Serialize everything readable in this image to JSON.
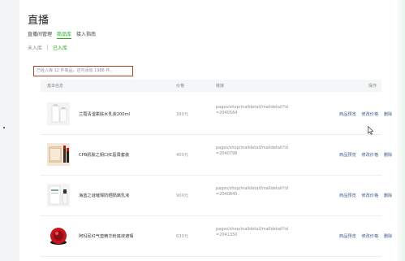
{
  "page": {
    "title": "直播"
  },
  "tabs": [
    {
      "label": "直播间管理"
    },
    {
      "label": "商品库"
    },
    {
      "label": "接入指南"
    }
  ],
  "subtabs": [
    {
      "label": "未入库"
    },
    {
      "label": "已入库"
    }
  ],
  "notice": "已经入库 12 件商品，还可添加 1988 件。",
  "table": {
    "headers": {
      "info": "基本信息",
      "price": "价格",
      "link": "链接",
      "actions": "操作"
    },
    "rows": [
      {
        "name": "兰蔻清滢柔肤水乳液200ml",
        "price": "390元",
        "link": "pages/shop/malldetail/malldetail?id=2040564",
        "icon": "lotion-bottle-icon"
      },
      {
        "name": "CPB肌肤之钥口红唇膏套装",
        "price": "400元",
        "link": "pages/shop/malldetail/malldetail?id=2040798",
        "icon": "lipstick-set-icon"
      },
      {
        "name": "海蓝之谜璀璨防晒隔离乳液",
        "price": "900元",
        "link": "pages/shop/malldetail/malldetail?id=2040845",
        "icon": "sunscreen-icon"
      },
      {
        "name": "阿玛尼红气垫精华粉底液遮瑕",
        "price": "630元",
        "link": "pages/shop/malldetail/malldetail?id=2041350",
        "icon": "cushion-compact-icon"
      }
    ],
    "actions": {
      "preview": "商品预览",
      "edit_price": "修改价格",
      "delete": "删除"
    }
  },
  "colors": {
    "accent": "#1aad19",
    "notice_border": "#b5432c",
    "action_link": "#3c5a8c"
  }
}
